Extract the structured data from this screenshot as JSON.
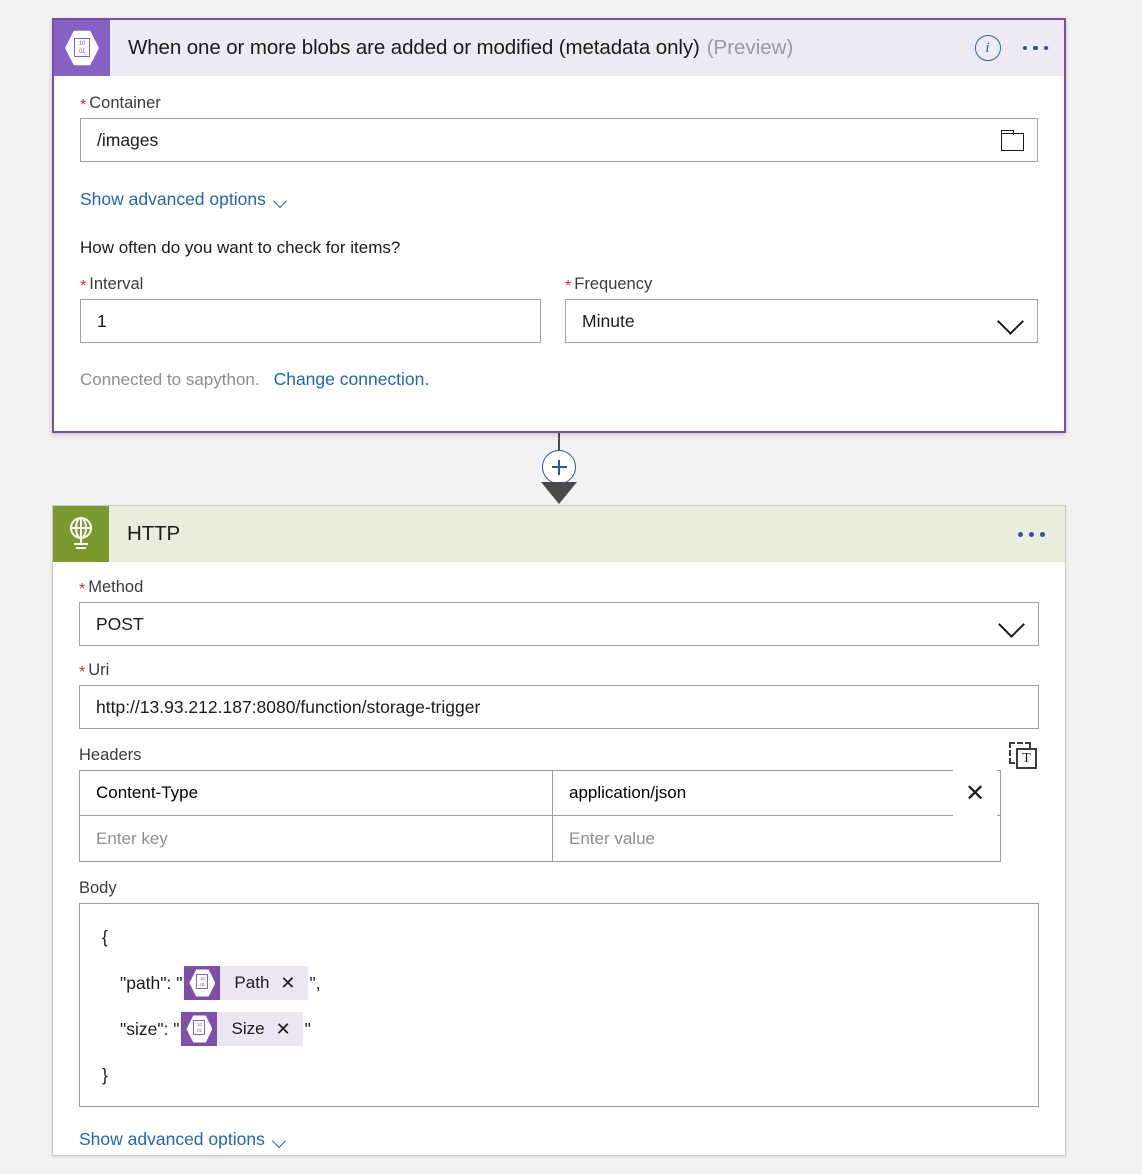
{
  "trigger_card": {
    "icon_name": "azure-blob-storage-icon",
    "icon_binary_top": "10",
    "icon_binary_bottom": "01",
    "title": "When one or more blobs are added or modified (metadata only)",
    "preview_label": "(Preview)",
    "info_glyph": "i",
    "fields": {
      "container": {
        "label": "Container",
        "required_marker": "*",
        "value": "/images",
        "browse_icon": "folder-icon"
      },
      "show_advanced": "Show advanced options",
      "question": "How often do you want to check for items?",
      "interval": {
        "label": "Interval",
        "required_marker": "*",
        "value": "1"
      },
      "frequency": {
        "label": "Frequency",
        "required_marker": "*",
        "value": "Minute"
      }
    },
    "connection_text": "Connected to sapython.",
    "change_connection_link": "Change connection."
  },
  "connector": {
    "add_step_glyph": "+"
  },
  "http_card": {
    "icon_name": "globe-icon",
    "title": "HTTP",
    "fields": {
      "method": {
        "label": "Method",
        "required_marker": "*",
        "value": "POST"
      },
      "uri": {
        "label": "Uri",
        "required_marker": "*",
        "value": "http://13.93.212.187:8080/function/storage-trigger"
      },
      "headers": {
        "label": "Headers",
        "rows": [
          {
            "key": "Content-Type",
            "value": "application/json",
            "is_placeholder": false
          },
          {
            "key": "Enter key",
            "value": "Enter value",
            "is_placeholder": true
          }
        ],
        "delete_glyph": "✕",
        "text_mode_icon": "switch-to-text-mode-icon",
        "text_mode_glyph": "T"
      },
      "body": {
        "label": "Body",
        "line_open": "{",
        "line_path_prefix": "\"path\": \"",
        "path_token": "Path",
        "line_path_suffix": "\",",
        "line_size_prefix": "\"size\": \"",
        "size_token": "Size",
        "line_size_suffix": "\"",
        "line_close": "}",
        "token_remove_glyph": "✕",
        "token_icon_binary_top": "10",
        "token_icon_binary_bottom": "01"
      },
      "show_advanced": "Show advanced options"
    }
  },
  "colors": {
    "trigger_accent": "#8661C5",
    "trigger_border": "#7A4F9E",
    "trigger_header_bg": "#EEEAF4",
    "http_accent": "#7a9a30",
    "http_header_bg": "#E9EDDC",
    "link": "#1f66b5",
    "required": "#c9352b",
    "token_icon_bg": "#7D4FA8",
    "token_label_bg": "#EDE5F4",
    "page_bg": "#f2f2f2"
  }
}
